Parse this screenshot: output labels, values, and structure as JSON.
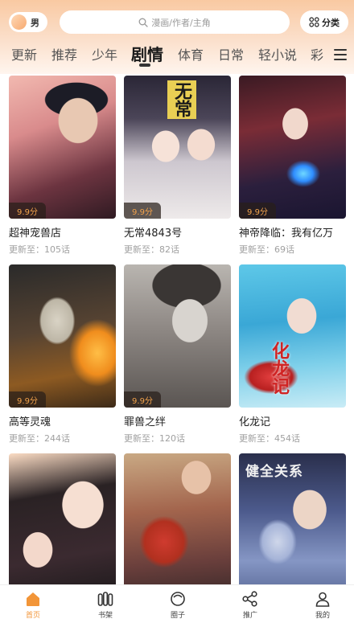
{
  "header": {
    "gender_label": "男",
    "search_placeholder": "漫画/作者/主角",
    "category_label": "分类",
    "accent_color": "#f29538"
  },
  "tabs": [
    {
      "label": "更新",
      "active": false
    },
    {
      "label": "推荐",
      "active": false
    },
    {
      "label": "少年",
      "active": false
    },
    {
      "label": "剧情",
      "active": true
    },
    {
      "label": "体育",
      "active": false
    },
    {
      "label": "日常",
      "active": false
    },
    {
      "label": "轻小说",
      "active": false
    },
    {
      "label": "彩",
      "active": false
    }
  ],
  "comics": [
    {
      "title": "超神宠兽店",
      "score": "9.9分",
      "update": "更新至：105话"
    },
    {
      "title": "无常4843号",
      "score": "9.9分",
      "update": "更新至：82话",
      "cover_text": "无常"
    },
    {
      "title": "神帝降临：我有亿万",
      "score": "9.9分",
      "update": "更新至：69话"
    },
    {
      "title": "高等灵魂",
      "score": "9.9分",
      "update": "更新至：244话"
    },
    {
      "title": "罪兽之绊",
      "score": "9.9分",
      "update": "更新至：120话"
    },
    {
      "title": "化龙记",
      "score": "",
      "update": "更新至：454话",
      "cover_text": "化龙记"
    },
    {
      "title": "",
      "score": "",
      "update": ""
    },
    {
      "title": "",
      "score": "",
      "update": ""
    },
    {
      "title": "",
      "score": "",
      "update": "",
      "cover_text": "健全关系"
    }
  ],
  "bottom_nav": [
    {
      "label": "首页",
      "icon": "home-icon",
      "active": true
    },
    {
      "label": "书架",
      "icon": "bookshelf-icon",
      "active": false
    },
    {
      "label": "圈子",
      "icon": "circle-icon",
      "active": false
    },
    {
      "label": "推广",
      "icon": "share-icon",
      "active": false
    },
    {
      "label": "我的",
      "icon": "user-icon",
      "active": false
    }
  ]
}
